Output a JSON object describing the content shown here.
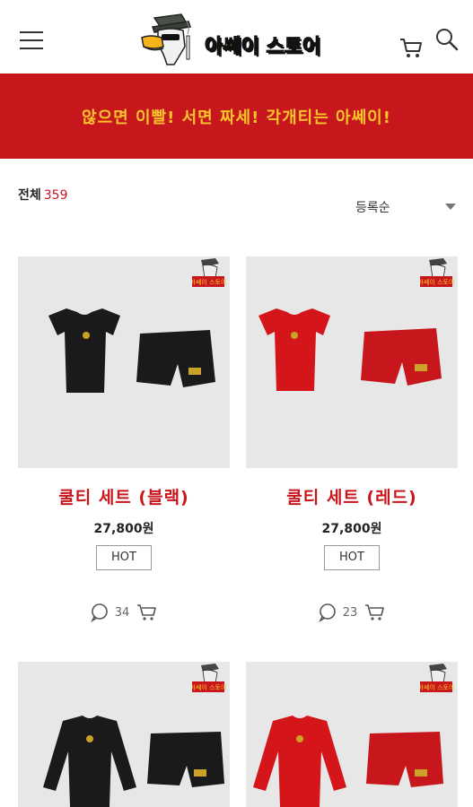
{
  "header": {
    "logo_text": "아쎄이 스토어"
  },
  "banner": {
    "text": "않으면 이빨! 서면 짜세! 각개티는 아쎄이!"
  },
  "filter": {
    "total_label": "전체",
    "total_count": "359",
    "sort_label": "등록순"
  },
  "products": [
    {
      "name": "쿨티 세트 (블랙)",
      "price": "27,800원",
      "tag": "HOT",
      "comments": "34",
      "badge_text": "아쎄이 스토어"
    },
    {
      "name": "쿨티 세트 (레드)",
      "price": "27,800원",
      "tag": "HOT",
      "comments": "23",
      "badge_text": "아쎄이 스토어"
    },
    {
      "badge_text": "아쎄이 스토어"
    },
    {
      "badge_text": "아쎄이 스토어"
    }
  ],
  "colors": {
    "brand_red": "#c8161d",
    "brand_yellow": "#f7c52a",
    "thumb_bg": "#e7e7e7"
  }
}
